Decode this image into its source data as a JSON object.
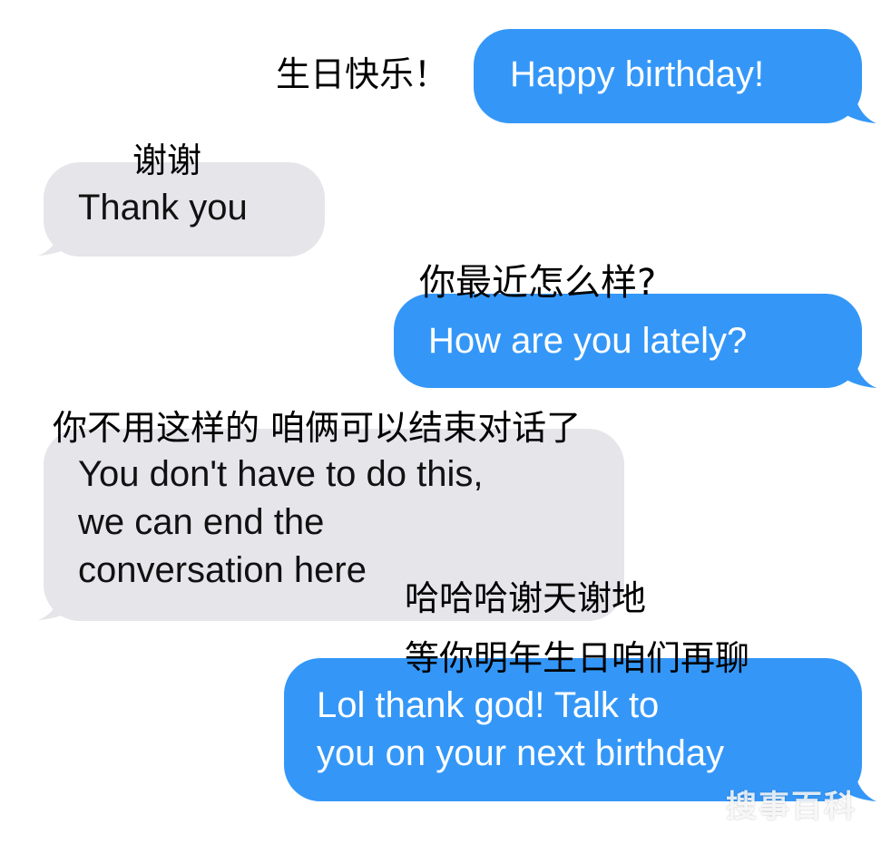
{
  "colors": {
    "sent_bubble": "#3497f8",
    "received_bubble": "#e5e5ea",
    "background": "#ffffff"
  },
  "messages": [
    {
      "direction": "sent",
      "text": "Happy birthday!",
      "translation": "生日快乐！"
    },
    {
      "direction": "received",
      "text": "Thank you",
      "translation": "谢谢"
    },
    {
      "direction": "sent",
      "text": "How are you lately?",
      "translation": "你最近怎么样?"
    },
    {
      "direction": "received",
      "text": "You don't have to do this,\nwe can end the\nconversation here",
      "translation": "你不用这样的 咱俩可以结束对话了"
    },
    {
      "direction": "sent",
      "text": "Lol thank god! Talk to\nyou on your next birthday",
      "translation_line1": "哈哈哈谢天谢地",
      "translation_line2": "等你明年生日咱们再聊"
    }
  ],
  "watermark": "搜事百科"
}
